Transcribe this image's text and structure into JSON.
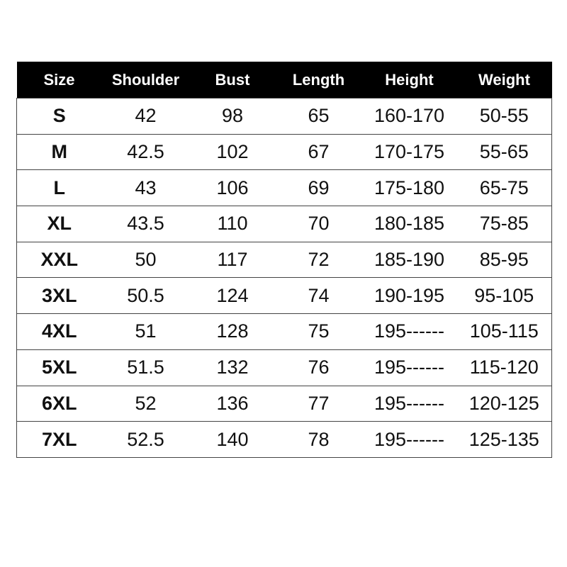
{
  "table": {
    "headers": [
      "Size",
      "Shoulder",
      "Bust",
      "Length",
      "Height",
      "Weight"
    ],
    "rows": [
      [
        "S",
        "42",
        "98",
        "65",
        "160-170",
        "50-55"
      ],
      [
        "M",
        "42.5",
        "102",
        "67",
        "170-175",
        "55-65"
      ],
      [
        "L",
        "43",
        "106",
        "69",
        "175-180",
        "65-75"
      ],
      [
        "XL",
        "43.5",
        "110",
        "70",
        "180-185",
        "75-85"
      ],
      [
        "XXL",
        "50",
        "117",
        "72",
        "185-190",
        "85-95"
      ],
      [
        "3XL",
        "50.5",
        "124",
        "74",
        "190-195",
        "95-105"
      ],
      [
        "4XL",
        "51",
        "128",
        "75",
        "195------",
        "105-115"
      ],
      [
        "5XL",
        "51.5",
        "132",
        "76",
        "195------",
        "115-120"
      ],
      [
        "6XL",
        "52",
        "136",
        "77",
        "195------",
        "120-125"
      ],
      [
        "7XL",
        "52.5",
        "140",
        "78",
        "195------",
        "125-135"
      ]
    ],
    "header_bg": "#000000",
    "header_text": "#ffffff"
  }
}
